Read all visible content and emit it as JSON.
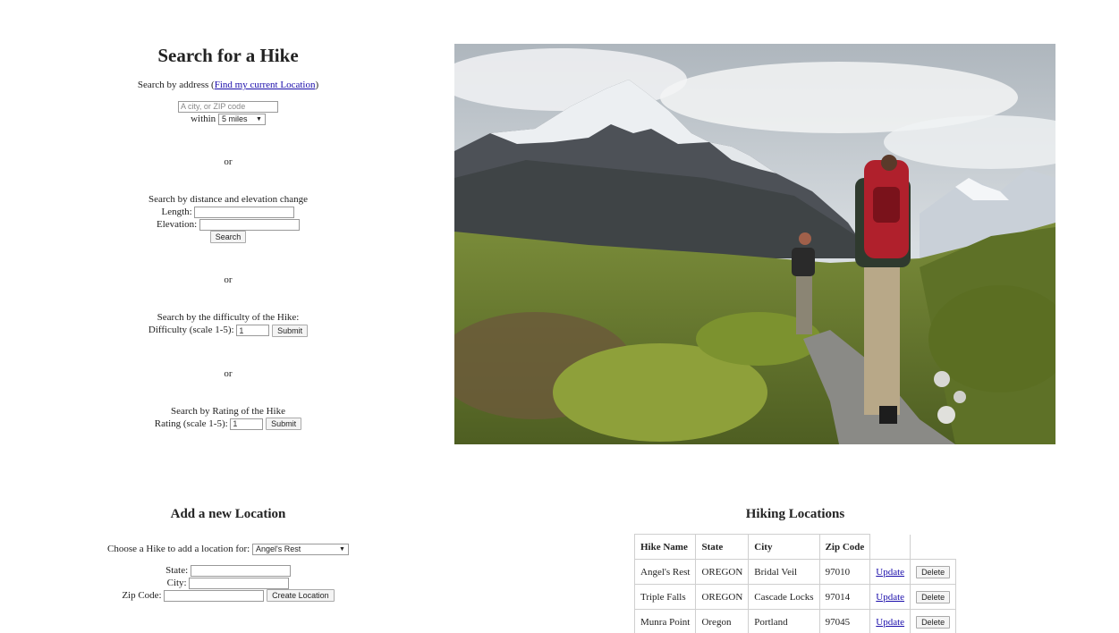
{
  "search": {
    "title": "Search for a Hike",
    "address_prefix": "Search by address (",
    "address_link": "Find my current Location",
    "address_suffix": ")",
    "address_placeholder": "A city, or ZIP code",
    "within_label": "within",
    "within_value": "5 miles",
    "or_label": "or",
    "distance_heading": "Search by distance and elevation change",
    "length_label": "Length:",
    "elevation_label": "Elevation:",
    "search_button": "Search",
    "difficulty_heading": "Search by the difficulty of the Hike:",
    "difficulty_label": "Difficulty (scale 1-5):",
    "difficulty_value": "1",
    "rating_heading": "Search by Rating of the Hike",
    "rating_label": "Rating (scale 1-5):",
    "rating_value": "1",
    "submit_button": "Submit"
  },
  "add_location": {
    "title": "Add a new Location",
    "choose_label": "Choose a Hike to add a location for:",
    "choose_value": "Angel's Rest",
    "state_label": "State:",
    "city_label": "City:",
    "zip_label": "Zip Code:",
    "create_button": "Create Location"
  },
  "locations": {
    "title": "Hiking Locations",
    "columns": [
      "Hike Name",
      "State",
      "City",
      "Zip Code"
    ],
    "rows": [
      {
        "name": "Angel's Rest",
        "state": "OREGON",
        "city": "Bridal Veil",
        "zip": "97010"
      },
      {
        "name": "Triple Falls",
        "state": "OREGON",
        "city": "Cascade Locks",
        "zip": "97014"
      },
      {
        "name": "Munra Point",
        "state": "Oregon",
        "city": "Portland",
        "zip": "97045"
      }
    ],
    "update_link": "Update",
    "delete_button": "Delete"
  },
  "icons": {
    "select_caret": "caret-down-icon"
  },
  "colors": {
    "link": "#1a0dab",
    "sky": "#c9d2d8",
    "grass": "#6f8a2e"
  }
}
